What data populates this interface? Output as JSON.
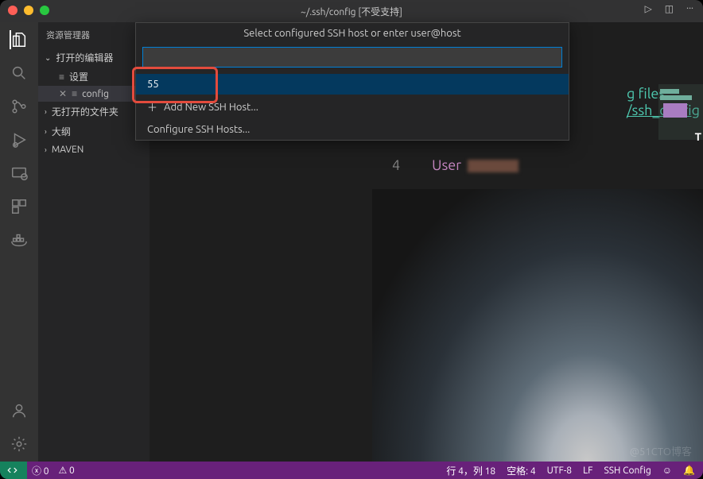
{
  "titlebar": {
    "title": "~/.ssh/config [不受支持]"
  },
  "toolbarRight": {
    "run": "▷",
    "split": "◫",
    "more": "···"
  },
  "explorer": {
    "title": "资源管理器",
    "sections": {
      "openEditors": "打开的编辑器",
      "settingsItem": "设置",
      "configItem": "config",
      "noFolder": "无打开的文件夹",
      "outline": "大纲",
      "maven": "MAVEN"
    }
  },
  "quickpick": {
    "prompt": "Select configured SSH host or enter user@host",
    "input": "",
    "items": {
      "selected": "55",
      "addNew": "Add New SSH Host...",
      "configure": "Configure SSH Hosts..."
    }
  },
  "editor": {
    "hintLine1": "g files:",
    "hintLine2": "/ssh_config",
    "userLine": {
      "num": "4",
      "keyword": "User"
    }
  },
  "statusbar": {
    "errors": "0",
    "warnings": "0",
    "lineCol": "行 4，列 18",
    "spaces": "空格: 4",
    "encoding": "UTF-8",
    "eol": "LF",
    "lang": "SSH Config"
  },
  "watermark": "@51CTO博客"
}
